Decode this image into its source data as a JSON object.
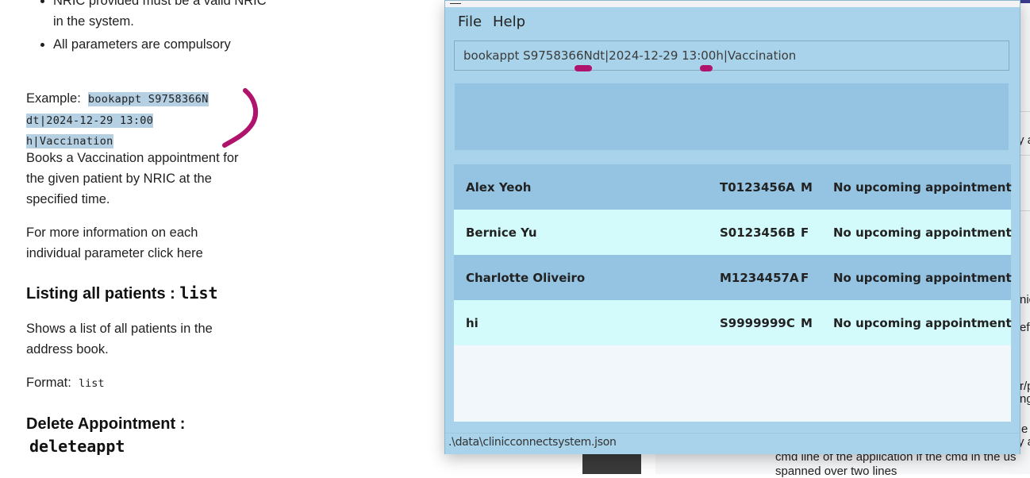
{
  "doc": {
    "bullets": [
      "NRIC provided must be a valid NRIC in the system.",
      "All parameters are compulsory"
    ],
    "example_label": "Example:",
    "example_code_1": "bookappt S9758366N",
    "example_code_2": "dt|2024-12-29 13:00",
    "example_code_3": "h|Vaccination",
    "description": "Books a Vaccination appointment for the given patient by NRIC at the specified time.",
    "more_info": "For more information on each individual parameter click here",
    "list_heading": "Listing all patients :",
    "list_cmd": "list",
    "list_desc": "Shows a list of all patients in the address book.",
    "format_label": "Format:",
    "format_cmd": "list",
    "delete_heading": "Delete Appointment :",
    "delete_cmd": "deleteappt"
  },
  "background_right": {
    "frag_1": "y a",
    "frag_2": "nic",
    "frag_3": "eft",
    "frag_4": "r/p",
    "frag_5": "ng",
    "frag_6": "e",
    "frag_7": "y a",
    "line_1": "cmd line of the application if the cmd in the us",
    "line_2": "spanned over two lines"
  },
  "app": {
    "menu": {
      "file": "File",
      "help": "Help"
    },
    "command_value": "bookappt S9758366Ndt|2024-12-29 13:00h|Vaccination",
    "result_text": "",
    "patients": [
      {
        "name": "Alex Yeoh",
        "nric": "T0123456A",
        "sex": "M",
        "appointment": "No upcoming appointment"
      },
      {
        "name": "Bernice Yu",
        "nric": "S0123456B",
        "sex": "F",
        "appointment": "No upcoming appointment"
      },
      {
        "name": "Charlotte Oliveiro",
        "nric": "M1234457A",
        "sex": "F",
        "appointment": "No upcoming appointment"
      },
      {
        "name": "hi",
        "nric": "S9999999C",
        "sex": "M",
        "appointment": "No upcoming appointment"
      }
    ],
    "status_path": ".\\data\\clinicconnectsystem.json",
    "colors": {
      "window_bg": "#a9d3ea",
      "row_odd": "#94c4e2",
      "row_even": "#d3fbfb",
      "pen_mark": "#b0136c"
    }
  }
}
